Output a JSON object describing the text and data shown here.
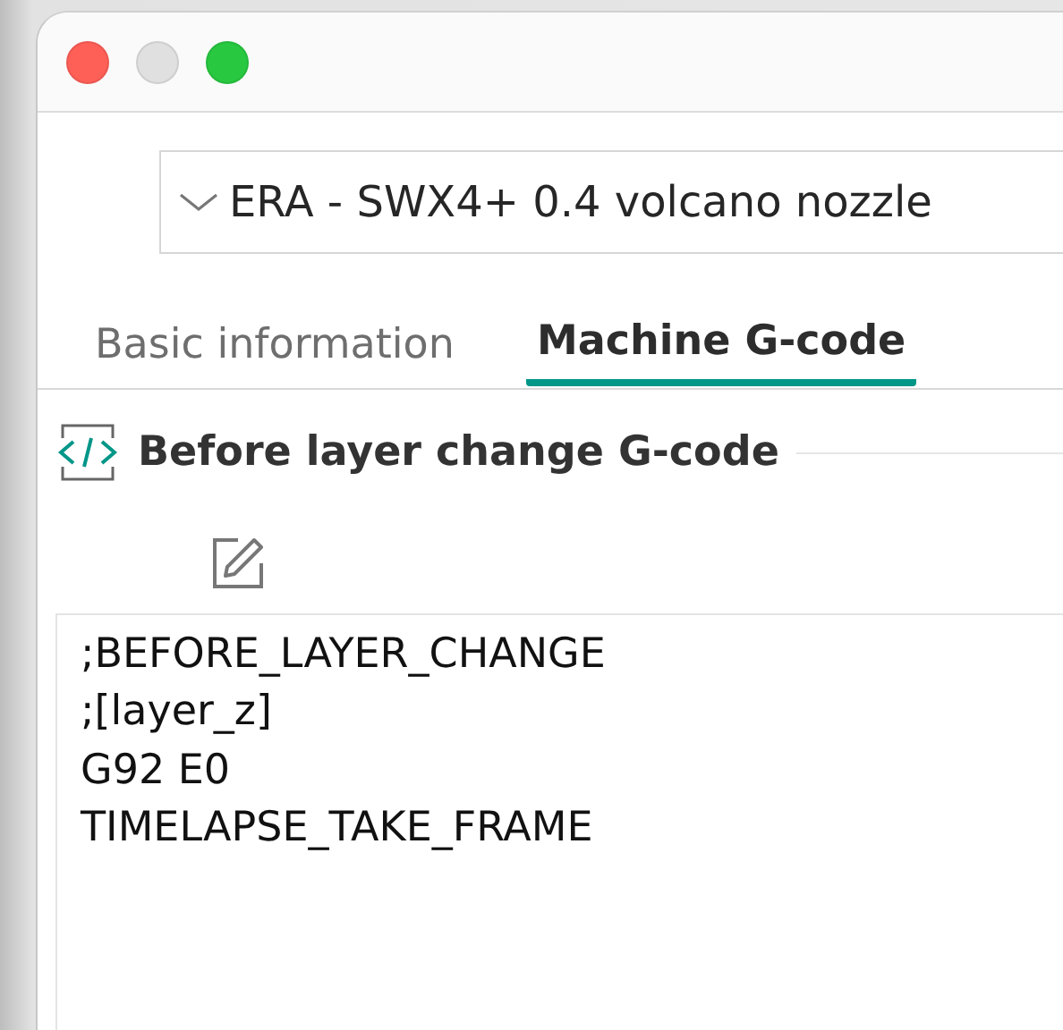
{
  "window": {
    "controls": [
      {
        "color": "#fe5f57"
      },
      {
        "color": "#e0e0e0"
      },
      {
        "color": "#28c840"
      }
    ]
  },
  "preset": {
    "value": "ERA - SWX4+ 0.4 volcano nozzle"
  },
  "tabs": [
    {
      "label": "Basic information",
      "selected": false
    },
    {
      "label": "Machine G-code",
      "selected": true
    }
  ],
  "section": {
    "title": "Before layer change G-code"
  },
  "gcode": {
    "lines": [
      ";BEFORE_LAYER_CHANGE",
      ";[layer_z]",
      "G92 E0",
      "TIMELAPSE_TAKE_FRAME"
    ]
  }
}
